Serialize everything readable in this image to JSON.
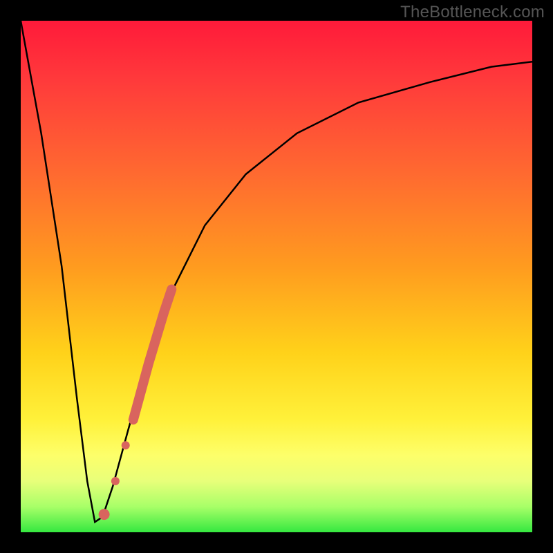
{
  "watermark": "TheBottleneck.com",
  "chart_data": {
    "type": "line",
    "title": "",
    "xlabel": "",
    "ylabel": "",
    "xlim": [
      0,
      100
    ],
    "ylim": [
      0,
      100
    ],
    "grid": false,
    "series": [
      {
        "name": "bottleneck-curve",
        "x": [
          0,
          4,
          8,
          11,
          13,
          14.5,
          16,
          18,
          21,
          25,
          30,
          36,
          44,
          54,
          66,
          80,
          92,
          100
        ],
        "y": [
          100,
          78,
          52,
          26,
          10,
          2,
          3,
          9,
          20,
          34,
          48,
          60,
          70,
          78,
          84,
          88,
          91,
          92
        ]
      },
      {
        "name": "highlight-points",
        "x": [
          16.3,
          18.5,
          20.5,
          22.0,
          23.5,
          25.0,
          26.5,
          28.0,
          29.5
        ],
        "y": [
          3.5,
          10.0,
          17.0,
          22.0,
          27.5,
          33.0,
          38.0,
          43.0,
          47.5
        ]
      }
    ],
    "gradient_stops": [
      {
        "pos": 0,
        "color": "#ff1a3a"
      },
      {
        "pos": 12,
        "color": "#ff3b3b"
      },
      {
        "pos": 30,
        "color": "#ff6a30"
      },
      {
        "pos": 48,
        "color": "#ff9b1f"
      },
      {
        "pos": 65,
        "color": "#ffd21a"
      },
      {
        "pos": 78,
        "color": "#fff13a"
      },
      {
        "pos": 85,
        "color": "#fdff6a"
      },
      {
        "pos": 90,
        "color": "#e8ff7a"
      },
      {
        "pos": 95,
        "color": "#a8ff68"
      },
      {
        "pos": 100,
        "color": "#35e840"
      }
    ],
    "highlight_color": "#d9645e"
  }
}
